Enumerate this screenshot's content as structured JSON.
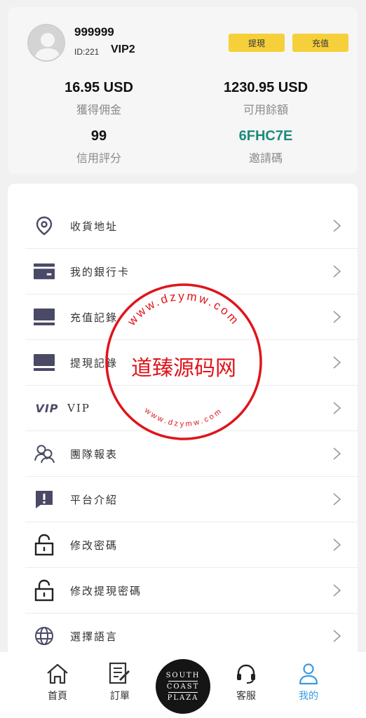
{
  "user": {
    "name": "999999",
    "id_label": "ID:221",
    "vip": "VIP2"
  },
  "actions": {
    "withdraw": "提現",
    "deposit": "充值"
  },
  "stats": {
    "commission_value": "16.95 USD",
    "commission_label": "獲得佣金",
    "balance_value": "1230.95 USD",
    "balance_label": "可用餘額",
    "credit_value": "99",
    "credit_label": "信用評分",
    "invite_value": "6FHC7E",
    "invite_label": "邀請碼"
  },
  "menu": [
    {
      "label": "收貨地址",
      "icon": "location-pin-icon"
    },
    {
      "label": "我的銀行卡",
      "icon": "bank-card-icon"
    },
    {
      "label": "充值記錄",
      "icon": "deposit-record-icon"
    },
    {
      "label": "提現記錄",
      "icon": "withdraw-record-icon"
    },
    {
      "label": "VIP",
      "icon": "vip-icon"
    },
    {
      "label": "團隊報表",
      "icon": "team-icon"
    },
    {
      "label": "平台介紹",
      "icon": "info-icon"
    },
    {
      "label": "修改密碼",
      "icon": "lock-icon"
    },
    {
      "label": "修改提現密碼",
      "icon": "lock-icon"
    },
    {
      "label": "選擇語言",
      "icon": "globe-icon"
    }
  ],
  "vip_badge": "VIP",
  "watermark": {
    "center_text": "道臻源码网",
    "ring_text": "www.dzymw.com"
  },
  "tabbar": {
    "home": "首頁",
    "orders": "訂單",
    "logo_line1": "SOUTH",
    "logo_line2": "COAST",
    "logo_line3": "PLAZA",
    "service": "客服",
    "mine": "我的"
  },
  "colors": {
    "accent_yellow": "#f6d03a",
    "invite_green": "#1c8c7a",
    "tab_active": "#3a9be0",
    "watermark_red": "#e0141c"
  }
}
